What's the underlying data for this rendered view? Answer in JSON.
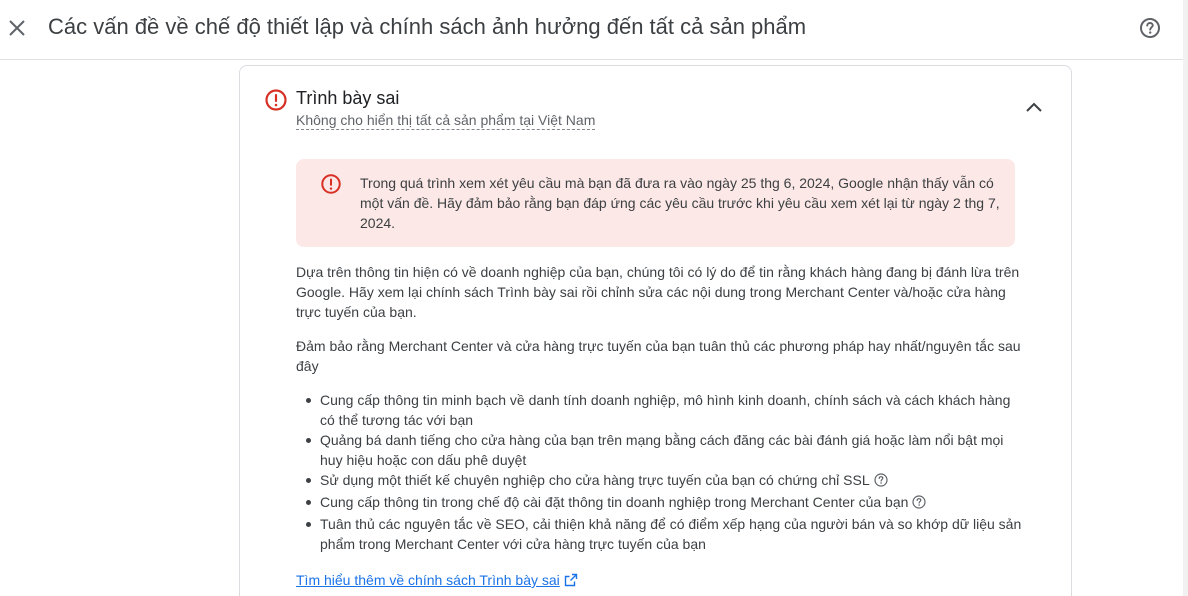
{
  "header": {
    "title": "Các vấn đề về chế độ thiết lập và chính sách ảnh hưởng đến tất cả sản phẩm",
    "close_icon": "close-icon",
    "help_icon": "help-circle-icon"
  },
  "issue": {
    "title": "Trình bày sai",
    "subtitle": "Không cho hiển thị tất cả sản phẩm tại Việt Nam",
    "status_icon": "error-circle-icon",
    "status_color": "#d93025",
    "collapse_icon": "chevron-up-icon"
  },
  "alert": {
    "text": "Trong quá trình xem xét yêu cầu mà bạn đã đưa ra vào ngày 25 thg 6, 2024, Google nhận thấy vẫn có một vấn đề. Hãy đảm bảo rằng bạn đáp ứng các yêu cầu trước khi yêu cầu xem xét lại từ ngày 2 thg 7, 2024.",
    "background": "#fce8e6",
    "icon": "error-circle-icon"
  },
  "description": {
    "paragraph1": "Dựa trên thông tin hiện có về doanh nghiệp của bạn, chúng tôi có lý do để tin rằng khách hàng đang bị đánh lừa trên Google. Hãy xem lại chính sách Trình bày sai rồi chỉnh sửa các nội dung trong Merchant Center và/hoặc cửa hàng trực tuyến của bạn.",
    "paragraph2": "Đảm bảo rằng Merchant Center và cửa hàng trực tuyến của bạn tuân thủ các phương pháp hay nhất/nguyên tắc sau đây",
    "bullets": [
      "Cung cấp thông tin minh bạch về danh tính doanh nghiệp, mô hình kinh doanh, chính sách và cách khách hàng có thể tương tác với bạn",
      "Quảng bá danh tiếng cho cửa hàng của bạn trên mạng bằng cách đăng các bài đánh giá hoặc làm nổi bật mọi huy hiệu hoặc con dấu phê duyệt",
      "Sử dụng một thiết kế chuyên nghiệp cho cửa hàng trực tuyến của bạn có chứng chỉ SSL",
      "Cung cấp thông tin trong chế độ cài đặt thông tin doanh nghiệp trong Merchant Center của bạn",
      "Tuân thủ các nguyên tắc về SEO, cải thiện khả năng để có điểm xếp hạng của người bán và so khớp dữ liệu sản phẩm trong Merchant Center với cửa hàng trực tuyến của bạn"
    ]
  },
  "learn_more": {
    "label": "Tìm hiểu thêm về chính sách Trình bày sai",
    "icon": "open-in-new-icon",
    "color": "#1a73e8"
  }
}
